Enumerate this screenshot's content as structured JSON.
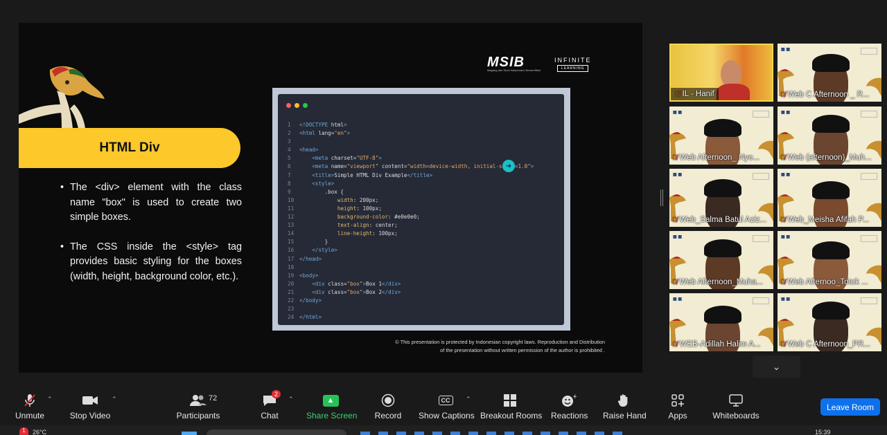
{
  "slide": {
    "banner_title": "HTML Div",
    "bullets": [
      "The <div> element with the class name \"box\" is used to create two simple boxes.",
      "The CSS inside the <style> tag provides basic styling for the boxes (width, height, background color, etc.)."
    ],
    "logo_msib": "MSIB",
    "logo_msib_tagline": "Magang dan Studi Independen Bersertifikat",
    "logo_infinite": "INFINITE",
    "logo_learning": "LEARNING",
    "copyright_line1": "© This presentation is protected by Indonesian copyright laws. Reproduction and Distribution",
    "copyright_line2": "of the presentation without written permission of the author is prohibited ."
  },
  "code_lines": [
    "<!DOCTYPE html>",
    "<html lang=\"en\">",
    "",
    "<head>",
    "    <meta charset=\"UTF-8\">",
    "    <meta name=\"viewport\" content=\"width=device-width, initial-scale=1.0\">",
    "    <title>Simple HTML Div Example</title>",
    "    <style>",
    "        .box {",
    "            width: 200px;",
    "            height: 100px;",
    "            background-color: #e0e0e0;",
    "            text-align: center;",
    "            line-height: 100px;",
    "        }",
    "    </style>",
    "</head>",
    "",
    "<body>",
    "    <div class=\"box\">Box 1</div>",
    "    <div class=\"box\">Box 2</div>",
    "</body>",
    "",
    "</html>"
  ],
  "participants": [
    {
      "name": "IL - Hanif",
      "active": true
    },
    {
      "name": "Web C Afternoon _ R..."
    },
    {
      "name": "Web Afternoon_ Nyo..."
    },
    {
      "name": "Web (afternoon)_Muh..."
    },
    {
      "name": "Web_Salma Batul Aziz..."
    },
    {
      "name": "Web_Meisha Afifah P..."
    },
    {
      "name": "Web Afternoon_Muha..."
    },
    {
      "name": "Web Afternoo_Totok ..."
    },
    {
      "name": "WEB-Adillah Halim A..."
    },
    {
      "name": "Web C Afternoon_PR..."
    }
  ],
  "toolbar": {
    "unmute": "Unmute",
    "stop_video": "Stop Video",
    "participants": "Participants",
    "participants_count": "72",
    "chat": "Chat",
    "chat_badge": "2",
    "share_screen": "Share Screen",
    "record": "Record",
    "show_captions": "Show Captions",
    "captions_icon_text": "CC",
    "breakout_rooms": "Breakout Rooms",
    "reactions": "Reactions",
    "raise_hand": "Raise Hand",
    "apps": "Apps",
    "whiteboards": "Whiteboards",
    "leave_room": "Leave Room"
  },
  "taskbar": {
    "temperature": "26°C",
    "time": "15:39"
  },
  "colors": {
    "banner": "#fcc82a",
    "share_green": "#27c35a",
    "leave_blue": "#0e71eb",
    "active_speaker": "#f2d94e",
    "muted_red": "#e0394a"
  }
}
